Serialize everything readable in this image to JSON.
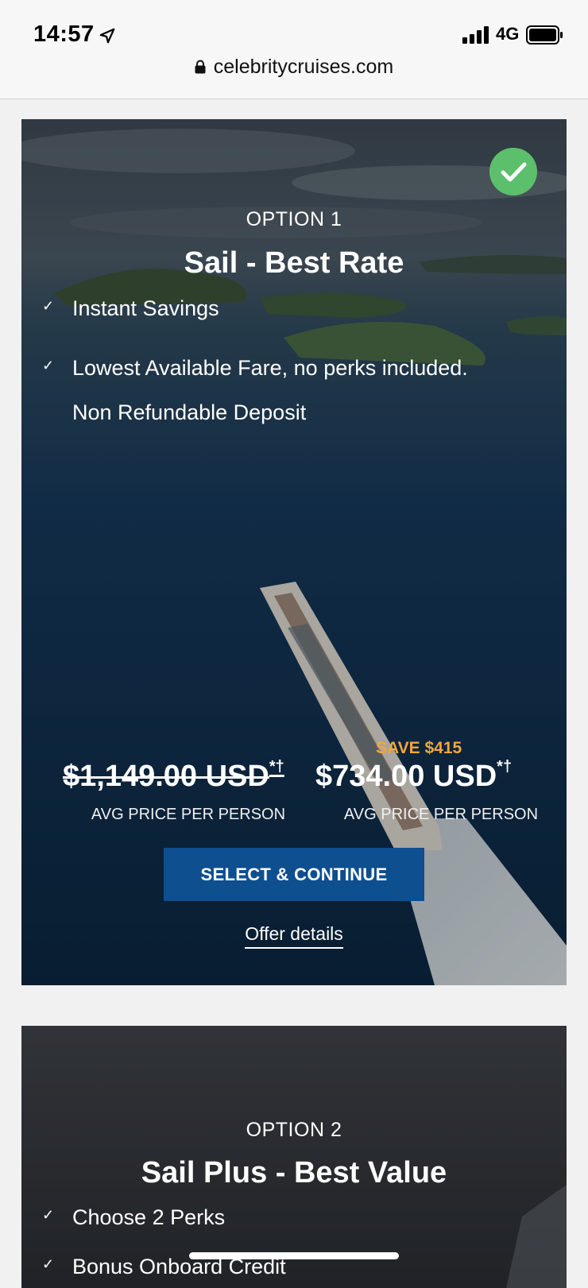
{
  "status": {
    "time": "14:57",
    "network": "4G",
    "url": "celebritycruises.com"
  },
  "icons": [
    "location-arrow-icon",
    "signal-icon",
    "battery-icon",
    "lock-icon",
    "checkmark-icon"
  ],
  "colors": {
    "accent_button": "#0d4f8f",
    "save_highlight": "#f2a73a",
    "selected_badge": "#5bbf6c"
  },
  "option1": {
    "label": "OPTION 1",
    "title": "Sail - Best Rate",
    "features": [
      "Instant Savings",
      "Lowest Available Fare, no perks included.",
      "Non Refundable Deposit"
    ],
    "feature_tick": "✓",
    "save": "SAVE $415",
    "price_old": "$1,149.00 USD",
    "price_new": "$734.00 USD",
    "price_suffix": "*†",
    "per_person_old": "AVG PRICE PER PERSON",
    "per_person_new": "AVG PRICE PER PERSON",
    "cta": "SELECT & CONTINUE",
    "offer_details": "Offer details",
    "selected": true
  },
  "option2": {
    "label": "OPTION 2",
    "title": "Sail Plus - Best Value",
    "features": [
      "Choose 2 Perks",
      "Bonus Onboard Credit"
    ],
    "feature_tick": "✓"
  }
}
